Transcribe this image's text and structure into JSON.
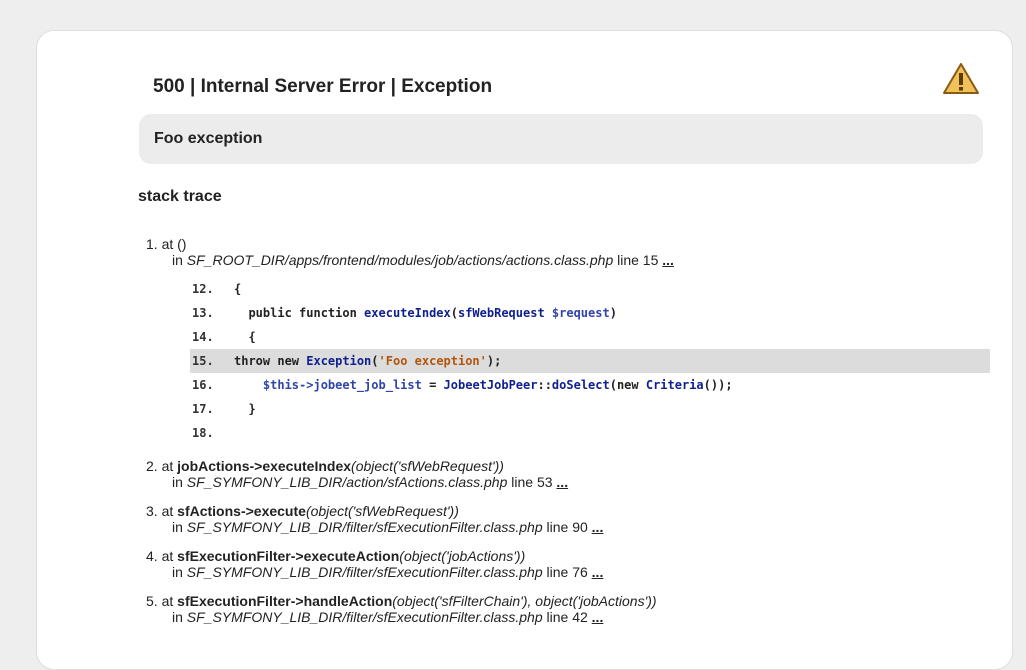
{
  "header": {
    "title": "500 | Internal Server Error | Exception",
    "warning_icon": "warning-triangle-icon"
  },
  "message": "Foo exception",
  "stack": {
    "heading": "stack trace",
    "frames": [
      {
        "num": "1.",
        "at": "at ()",
        "in_prefix": "in ",
        "file": "SF_ROOT_DIR/apps/frontend/modules/job/actions/actions.class.php",
        "line_text": " line 15 ",
        "more": "..."
      },
      {
        "num": "2.",
        "at_prefix": "at ",
        "function": "jobActions->executeIndex",
        "args": "(object('sfWebRequest'))",
        "in_prefix": "in ",
        "file": "SF_SYMFONY_LIB_DIR/action/sfActions.class.php",
        "line_text": " line 53 ",
        "more": "..."
      },
      {
        "num": "3.",
        "at_prefix": "at ",
        "function": "sfActions->execute",
        "args": "(object('sfWebRequest'))",
        "in_prefix": "in ",
        "file": "SF_SYMFONY_LIB_DIR/filter/sfExecutionFilter.class.php",
        "line_text": " line 90 ",
        "more": "..."
      },
      {
        "num": "4.",
        "at_prefix": "at ",
        "function": "sfExecutionFilter->executeAction",
        "args": "(object('jobActions'))",
        "in_prefix": "in ",
        "file": "SF_SYMFONY_LIB_DIR/filter/sfExecutionFilter.class.php",
        "line_text": " line 76 ",
        "more": "..."
      },
      {
        "num": "5.",
        "at_prefix": "at ",
        "function": "sfExecutionFilter->handleAction",
        "args": "(object('sfFilterChain'), object('jobActions'))",
        "in_prefix": "in ",
        "file": "SF_SYMFONY_LIB_DIR/filter/sfExecutionFilter.class.php",
        "line_text": " line 42 ",
        "more": "..."
      }
    ],
    "code": [
      {
        "num": "12.",
        "text": "{"
      },
      {
        "num": "13.",
        "text": "  public function ",
        "fn": "executeIndex",
        "rest": "(",
        "type": "sfWebRequest",
        "var": " $request",
        "end": ")"
      },
      {
        "num": "14.",
        "text": "  {"
      },
      {
        "num": "15.",
        "text": "throw new ",
        "cls": "Exception",
        "open": "(",
        "str": "'Foo exception'",
        "end": ");"
      },
      {
        "num": "16.",
        "text": "    ",
        "var": "$this->jobeet_job_list",
        "mid": " = ",
        "cls": "JobeetJobPeer",
        "sep": "::",
        "fn": "doSelect",
        "open": "(new ",
        "cls2": "Criteria",
        "end": "());"
      },
      {
        "num": "17.",
        "text": "  }"
      },
      {
        "num": "18.",
        "text": ""
      }
    ]
  }
}
